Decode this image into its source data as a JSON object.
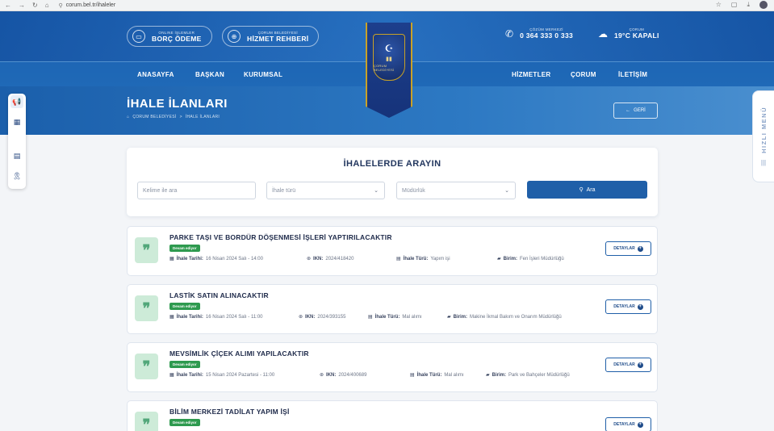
{
  "browser": {
    "url": "corum.bel.tr/ihaleler"
  },
  "header": {
    "pill1": {
      "small": "ONLINE İŞLEMLER",
      "big": "BORÇ ÖDEME"
    },
    "pill2": {
      "small": "ÇORUM BELEDİYESİ",
      "big": "HİZMET REHBERİ"
    },
    "crest_text": "ÇORUM BELEDİYESİ",
    "phone": {
      "small": "ÇÖZÜM MERKEZİ",
      "big": "0 364 333 0 333"
    },
    "weather": {
      "small": "ÇORUM",
      "big": "19°C KAPALI"
    },
    "nav_left": [
      "ANASAYFA",
      "BAŞKAN",
      "KURUMSAL"
    ],
    "nav_right": [
      "HİZMETLER",
      "ÇORUM",
      "İLETİŞİM"
    ],
    "page_title": "İHALE İLANLARI",
    "breadcrumb": [
      "ÇORUM BELEDİYESİ",
      ">",
      "İHALE İLANLARI"
    ],
    "back_label": "GERİ"
  },
  "quick_menu": {
    "label": "HIZLI MENÜ"
  },
  "search": {
    "title": "İHALELERDE ARAYIN",
    "keyword_placeholder": "Kelime ile ara",
    "type_placeholder": "İhale türü",
    "dept_placeholder": "Müdürlük",
    "button_label": "Ara"
  },
  "labels": {
    "date": "İhale Tarihi:",
    "ikn": "IKN:",
    "type": "İhale Türü:",
    "unit": "Birim:",
    "details": "DETAYLAR"
  },
  "tenders": [
    {
      "title": "PARKE TAŞI VE BORDÜR DÖŞENMESİ İŞLERİ YAPTIRILACAKTIR",
      "status": "Devam ediyor",
      "date": "16 Nisan 2024 Salı - 14:00",
      "ikn": "2024/418420",
      "type": "Yapım işi",
      "unit": "Fen İşleri Müdürlüğü"
    },
    {
      "title": "LASTİK SATIN ALINACAKTIR",
      "status": "Devam ediyor",
      "date": "16 Nisan 2024 Salı - 11:00",
      "ikn": "2024/393155",
      "type": "Mal alımı",
      "unit": "Makine İkmal Bakım ve Onarım Müdürlüğü"
    },
    {
      "title": "MEVSİMLİK ÇİÇEK ALIMI YAPILACAKTIR",
      "status": "Devam ediyor",
      "date": "15 Nisan 2024 Pazartesi - 11:00",
      "ikn": "2024/400689",
      "type": "Mal alımı",
      "unit": "Park ve Bahçeler Müdürlüğü"
    },
    {
      "title": "BİLİM MERKEZİ TADİLAT YAPIM İŞİ",
      "status": "Devam ediyor"
    }
  ]
}
